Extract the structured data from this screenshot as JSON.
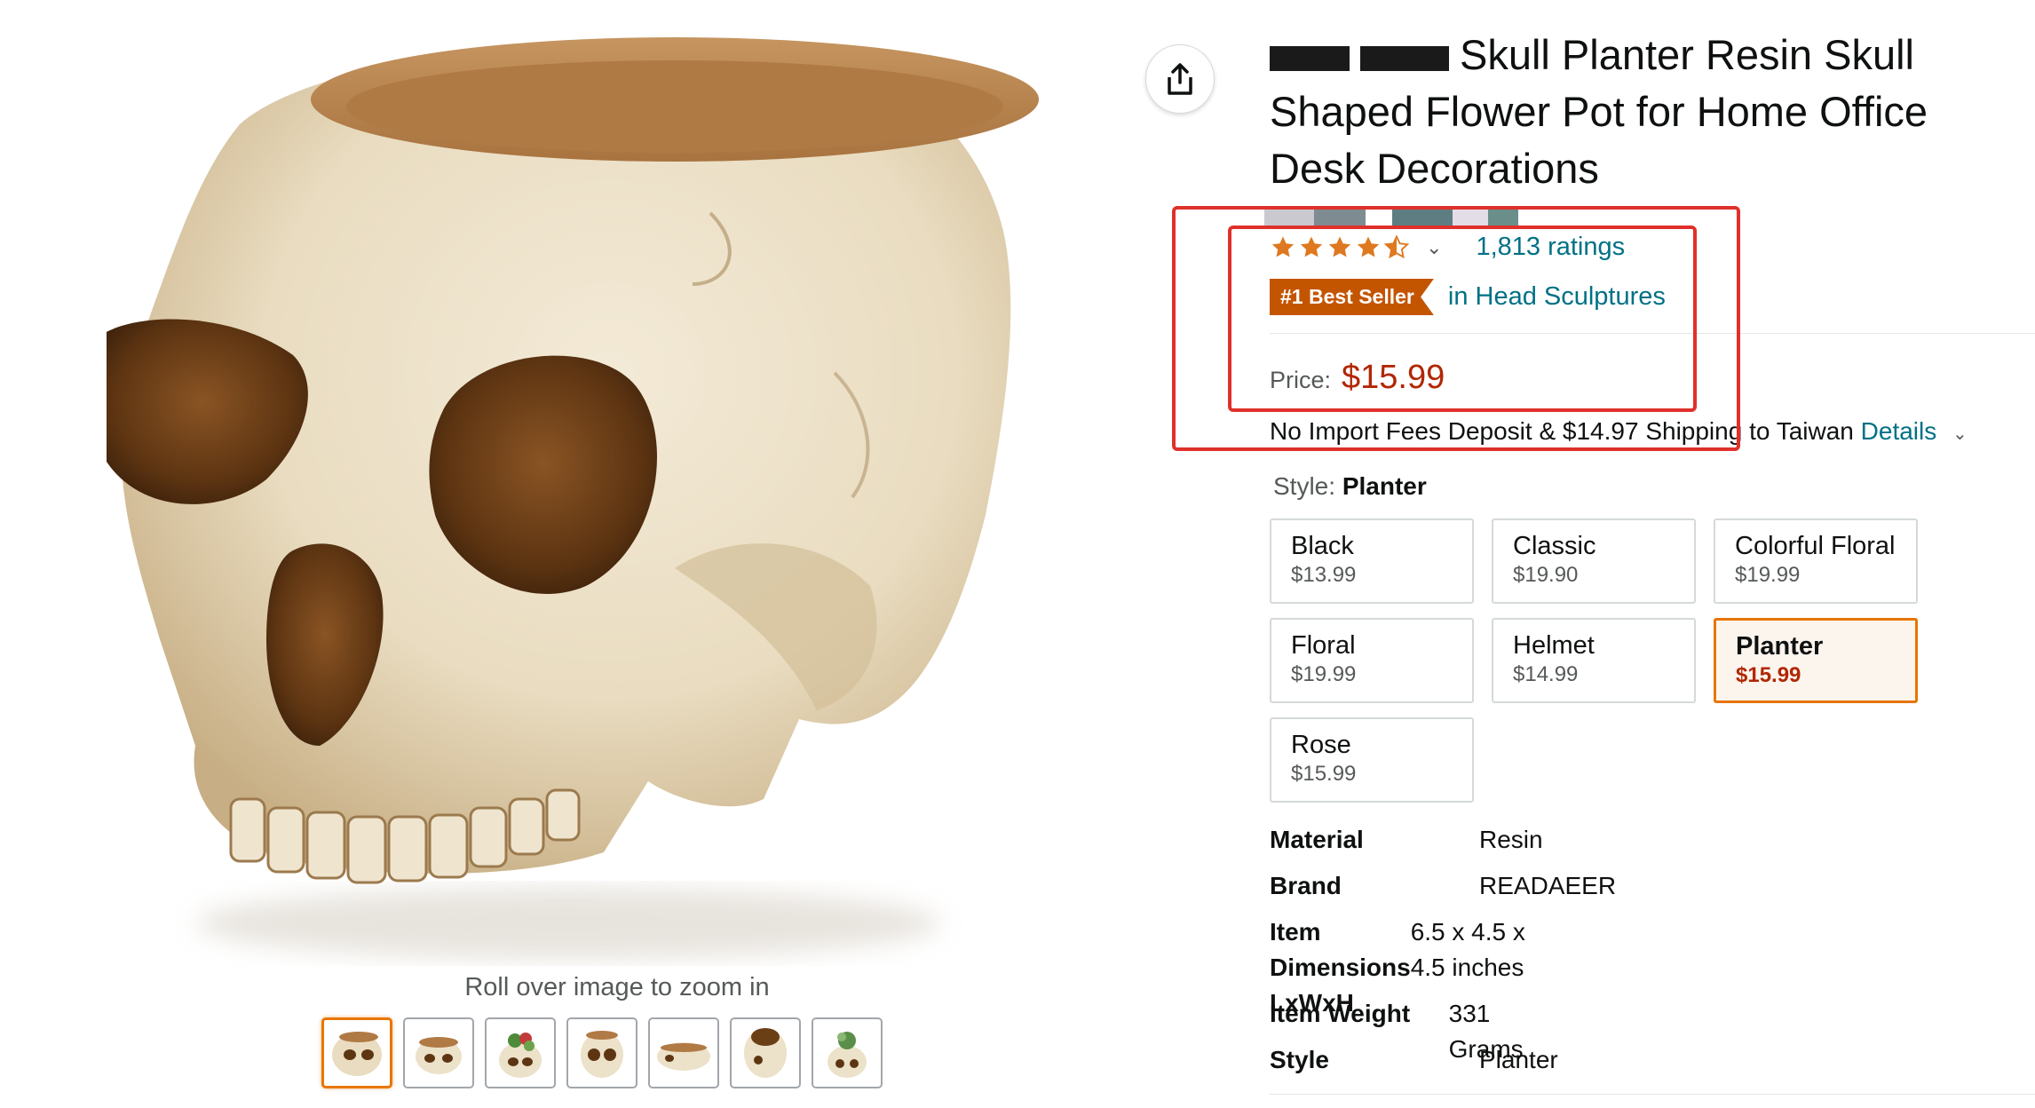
{
  "product": {
    "title": "Skull Planter Resin Skull Shaped Flower Pot for Home Office Desk Decorations",
    "rating": {
      "stars": 4.5,
      "ratings_text": "1,813 ratings"
    },
    "best_seller": {
      "badge": "#1 Best Seller",
      "category": "in Head Sculptures"
    },
    "price": {
      "label": "Price:",
      "value": "$15.99"
    },
    "shipping": {
      "text": "No Import Fees Deposit & $14.97 Shipping to Taiwan",
      "details_link": "Details"
    }
  },
  "gallery": {
    "zoom_hint": "Roll over image to zoom in",
    "thumbnail_count": 7,
    "active_thumbnail": 1
  },
  "style_selector": {
    "label": "Style:",
    "selected": "Planter",
    "options": [
      {
        "name": "Black",
        "price": "$13.99"
      },
      {
        "name": "Classic",
        "price": "$19.90"
      },
      {
        "name": "Colorful Floral",
        "price": "$19.99"
      },
      {
        "name": "Floral",
        "price": "$19.99"
      },
      {
        "name": "Helmet",
        "price": "$14.99"
      },
      {
        "name": "Planter",
        "price": "$15.99"
      },
      {
        "name": "Rose",
        "price": "$15.99"
      }
    ]
  },
  "specs": [
    {
      "key": "Material",
      "value": "Resin"
    },
    {
      "key": "Brand",
      "value": "READAEER"
    },
    {
      "key": "Item Dimensions LxWxH",
      "value": "6.5 x 4.5 x 4.5 inches"
    },
    {
      "key": "Item Weight",
      "value": "331 Grams"
    },
    {
      "key": "Style",
      "value": "Planter"
    }
  ],
  "colors": {
    "link": "#007185",
    "price": "#b12704",
    "badge": "#c45500",
    "highlight_box": "#e0302a",
    "selected_border": "#e77600",
    "star": "#de7921"
  },
  "icons": {
    "share": "share-icon",
    "chevron": "chevron-down-icon",
    "star": "star-icon"
  }
}
